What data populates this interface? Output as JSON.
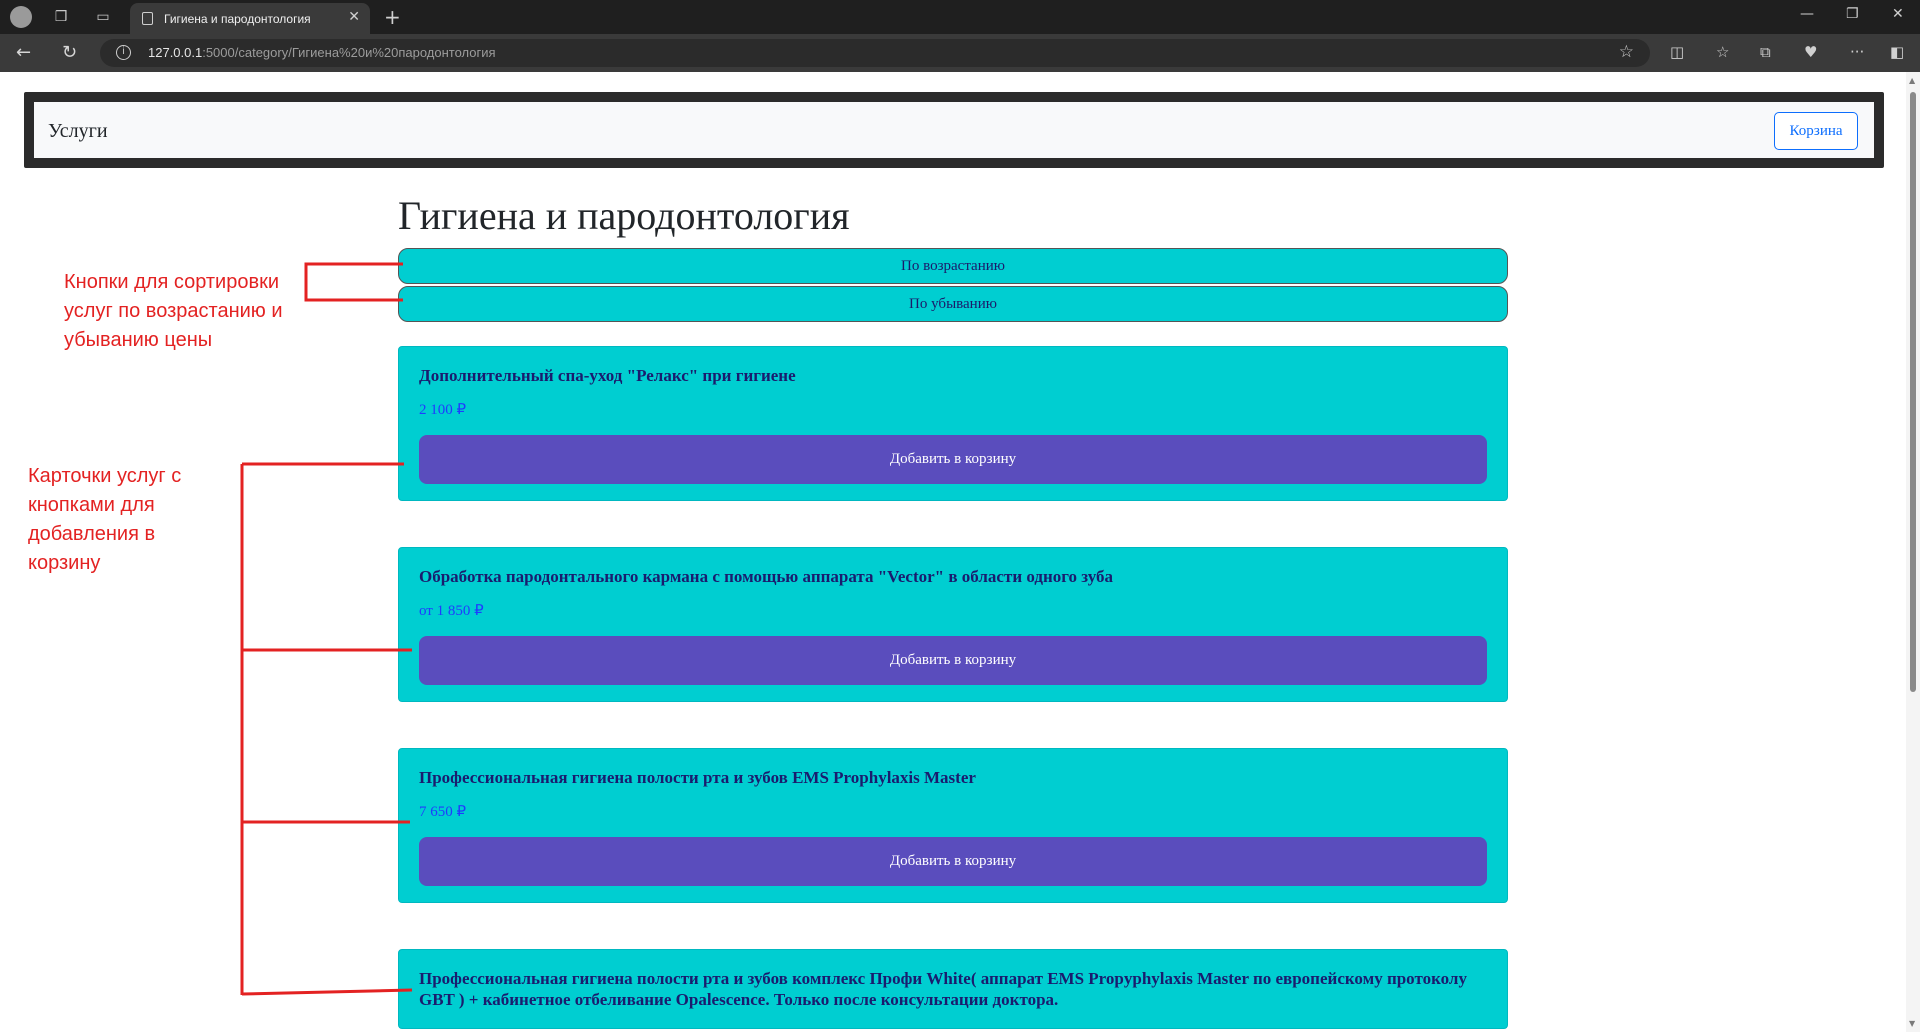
{
  "browser": {
    "tab_title": "Гигиена и пародонтология",
    "url_host": "127.0.0.1",
    "url_path": ":5000/category/Гигиена%20и%20пародонтология"
  },
  "navbar": {
    "brand": "Услуги",
    "cart_label": "Корзина"
  },
  "page": {
    "title": "Гигиена и пародонтология",
    "sort_asc_label": "По возрастанию",
    "sort_desc_label": "По убыванию"
  },
  "cards": [
    {
      "name": "Дополнительный спа-уход \"Релакс\" при гигиене",
      "price": "2 100 ₽",
      "button": "Добавить в корзину"
    },
    {
      "name": "Обработка пародонтального кармана с помощью аппарата \"Vector\" в области одного зуба",
      "price": "от 1 850 ₽",
      "button": "Добавить в корзину"
    },
    {
      "name": "Профессиональная гигиена полости рта и зубов EMS Prophylaxis Master",
      "price": "7 650 ₽",
      "button": "Добавить в корзину"
    },
    {
      "name": "Профессиональная гигиена полости рта и зубов комплекс Профи White( аппарат EMS Propyphylaxis Master по европейскому протоколу GBT ) + кабинетное отбеливание Opalescence. Только после консультации доктора."
    }
  ],
  "annotations": {
    "sort_note": "Кнопки для сортировки услуг по возрастанию и убыванию цены",
    "cards_note": "Карточки услуг с кнопками для добавления в корзину"
  },
  "colors": {
    "card_bg": "#00ced1",
    "add_button_bg": "#5a4dbd",
    "annotation": "#e32222",
    "cart_outline": "#0d6efd"
  }
}
